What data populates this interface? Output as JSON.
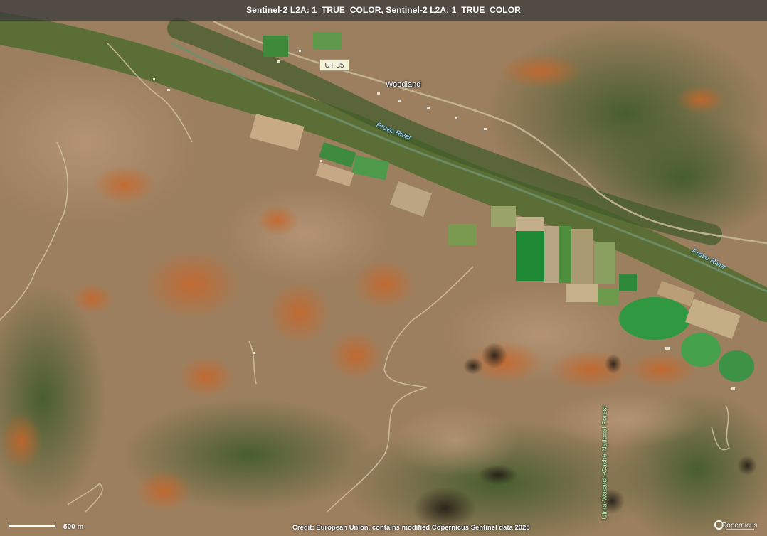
{
  "viewer": {
    "layer_title": "Sentinel-2 L2A: 1_TRUE_COLOR, Sentinel-2 L2A: 1_TRUE_COLOR"
  },
  "map": {
    "road_shield": "UT 35",
    "places": {
      "town": "Woodland"
    },
    "rivers": {
      "upper": "Provo River",
      "lower": "Provo River"
    },
    "forest": "Uinta-Wasatch-Cache National Forest",
    "colors": {
      "terrain": "#9c7f5f",
      "vegetation": "#5f7a3a",
      "dark_vegetation": "#3f5a2a",
      "autumn_foliage": "#c7662a",
      "field_green": "#2f8c3a",
      "road": "#d8cbb0",
      "river": "#a9d6ee"
    }
  },
  "scale": {
    "label": "500 m"
  },
  "credit": "Credit: European Union, contains modified Copernicus Sentinel data 2025",
  "logo": {
    "text": "Copernicus"
  }
}
